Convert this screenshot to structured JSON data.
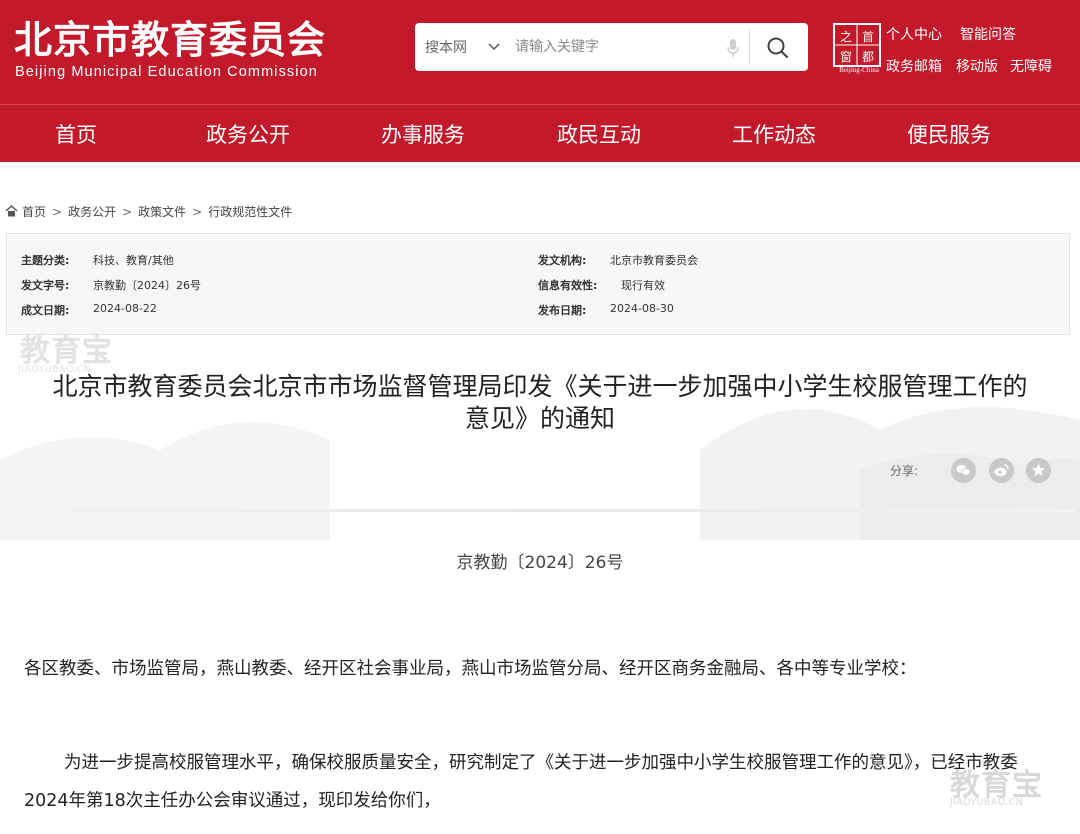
{
  "header": {
    "logo_cn": "北京市教育委员会",
    "logo_en": "Beijing Municipal Education Commission",
    "search": {
      "scope": "搜本网",
      "placeholder": "请输入关键字"
    },
    "seal_text": "首都之窗",
    "seal_en": "Beijing-China",
    "top_links": [
      "个人中心",
      "智能问答",
      "政务邮箱",
      "移动版",
      "无障碍"
    ]
  },
  "nav": {
    "items": [
      "首页",
      "政务公开",
      "办事服务",
      "政民互动",
      "工作动态",
      "便民服务"
    ]
  },
  "breadcrumb": {
    "items": [
      "首页",
      "政务公开",
      "政策文件",
      "行政规范性文件"
    ],
    "separator": ">"
  },
  "meta": {
    "topic_label": "主题分类:",
    "topic_value": "科技、教育/其他",
    "issuer_label": "发文机构:",
    "issuer_value": "北京市教育委员会",
    "docno_label": "发文字号:",
    "docno_value": "京教勤〔2024〕26号",
    "validity_label": "信息有效性:",
    "validity_value": "现行有效",
    "created_label": "成文日期:",
    "created_value": "2024-08-22",
    "published_label": "发布日期:",
    "published_value": "2024-08-30"
  },
  "watermark": {
    "brand": "教育宝",
    "domain": "JIAOYUBAO.CN"
  },
  "document": {
    "title_line1": "北京市教育委员会北京市市场监督管理局印发《关于进一步加强中小学生校服管理工作的",
    "title_line2": "意见》的通知",
    "share_label": "分享:",
    "share_icons": [
      "wechat-icon",
      "weibo-icon",
      "favorite-icon"
    ],
    "doc_number": "京教勤〔2024〕26号",
    "paragraph_1": "各区教委、市场监管局，燕山教委、经开区社会事业局，燕山市场监管分局、经开区商务金融局、各中等专业学校：",
    "paragraph_2": "为进一步提高校服管理水平，确保校服质量安全，研究制定了《关于进一步加强中小学生校服管理工作的意见》，已经市教委2024年第18次主任办公会审议通过，现印发给你们，"
  },
  "colors": {
    "brand_red": "#c2192b",
    "meta_bg": "#f7f7f7",
    "share_gray": "#c9c9c9"
  }
}
